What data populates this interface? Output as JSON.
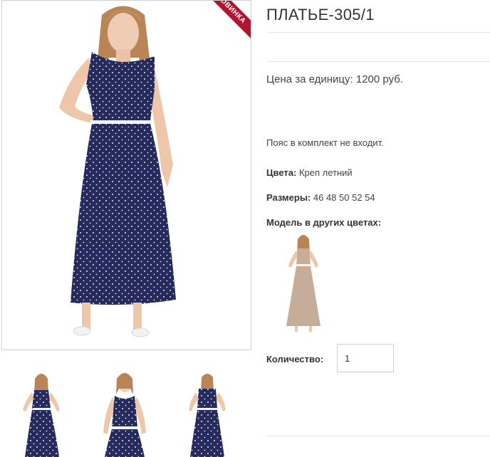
{
  "product": {
    "title": "ПЛАТЬЕ-305/1",
    "badge": "НОВИНКА",
    "price_label": "Цена за единицу:",
    "price_value": "1200 руб.",
    "note": "Пояс в комплект не входит.",
    "colors_label": "Цвета:",
    "colors_value": "Креп летний",
    "sizes_label": "Размеры:",
    "sizes_value": "46 48 50 52 54",
    "other_colors_label": "Модель в других цветах:"
  },
  "quantity": {
    "label": "Количество:",
    "value": "1"
  },
  "colors": {
    "dress_navy": "#262a5c",
    "dress_beige": "#c5ad9a",
    "badge_red": "#b5122f"
  },
  "images": {
    "main": "dress-model-photo",
    "thumbnails": [
      "dress-front-thumb",
      "dress-closeup-thumb",
      "dress-back-thumb"
    ],
    "other_color": "beige-dress-thumb"
  }
}
